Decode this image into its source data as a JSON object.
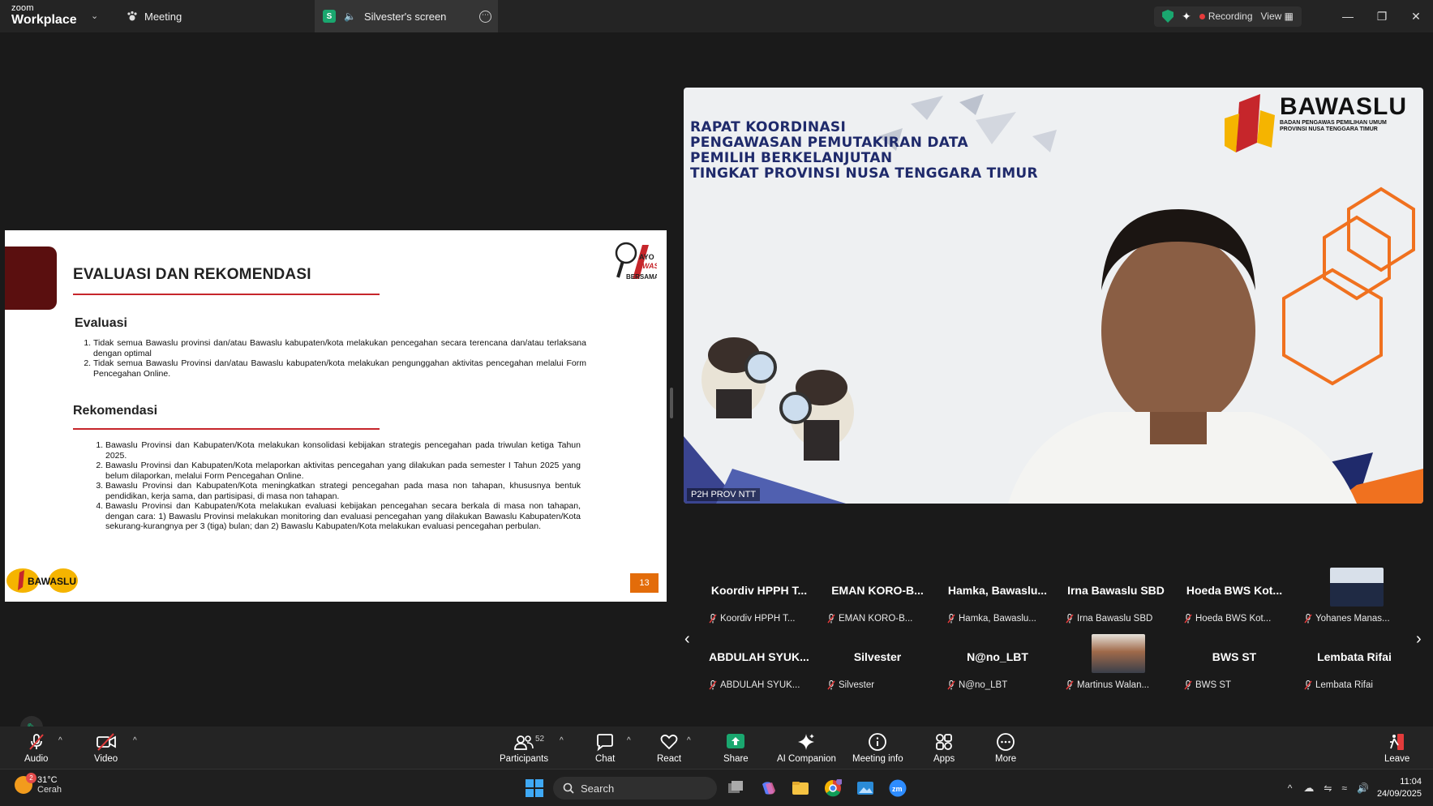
{
  "app": {
    "logo_small": "zoom",
    "logo_big": "Workplace",
    "meeting_tab": "Meeting",
    "screen_tab": "Silvester's screen",
    "screen_tab_badge": "S",
    "status": {
      "recording": "Recording",
      "view": "View"
    }
  },
  "slide": {
    "title": "EVALUASI DAN REKOMENDASI",
    "ayo_logo_text": "AYO AWASI BERSAMA",
    "eval_heading": "Evaluasi",
    "eval_items": [
      "Tidak semua Bawaslu provinsi dan/atau Bawaslu kabupaten/kota melakukan pencegahan secara terencana dan/atau terlaksana dengan optimal",
      "Tidak semua Bawaslu Provinsi dan/atau Bawaslu kabupaten/kota melakukan pengunggahan aktivitas pencegahan melalui Form Pencegahan Online."
    ],
    "rek_heading": "Rekomendasi",
    "rek_items": [
      "Bawaslu Provinsi dan Kabupaten/Kota melakukan konsolidasi kebijakan strategis pencegahan pada triwulan ketiga Tahun 2025.",
      "Bawaslu Provinsi dan Kabupaten/Kota melaporkan aktivitas pencegahan yang dilakukan pada semester I Tahun 2025 yang belum dilaporkan, melalui Form Pencegahan Online.",
      "Bawaslu Provinsi dan Kabupaten/Kota meningkatkan strategi pencegahan pada masa non tahapan, khususnya bentuk pendidikan, kerja sama, dan partisipasi, di masa non tahapan.",
      "Bawaslu Provinsi dan Kabupaten/Kota melakukan evaluasi kebijakan pencegahan secara berkala di masa non tahapan, dengan cara: 1) Bawaslu Provinsi melakukan monitoring dan evaluasi pencegahan yang dilakukan Bawaslu Kabupaten/Kota sekurang-kurangnya per 3 (tiga) bulan; dan 2) Bawaslu Kabupaten/Kota melakukan evaluasi pencegahan perbulan."
    ],
    "footer_logo": "BAWASLU",
    "page_number": "13"
  },
  "video": {
    "banner_lines": [
      "RAPAT KOORDINASI",
      "PENGAWASAN PEMUTAKIRAN DATA",
      "PEMILIH BERKELANJUTAN",
      "TINGKAT PROVINSI NUSA TENGGARA TIMUR"
    ],
    "logo_big": "BAWASLU",
    "logo_small_1": "BADAN PENGAWAS PEMILIHAN UMUM",
    "logo_small_2": "PROVINSI NUSA TENGGARA TIMUR",
    "name": "P2H PROV NTT"
  },
  "participants": [
    {
      "title": "Koordiv HPPH T...",
      "label": "Koordiv HPPH T..."
    },
    {
      "title": "EMAN KORO-B...",
      "label": "EMAN KORO-B..."
    },
    {
      "title": "Hamka,  Bawaslu...",
      "label": "Hamka, Bawaslu..."
    },
    {
      "title": "Irna Bawaslu SBD",
      "label": "Irna Bawaslu SBD"
    },
    {
      "title": "Hoeda BWS Kot...",
      "label": "Hoeda BWS Kot..."
    },
    {
      "title": "",
      "label": "Yohanes Manas..."
    },
    {
      "title": "ABDULAH SYUK...",
      "label": "ABDULAH SYUK..."
    },
    {
      "title": "Silvester",
      "label": "Silvester"
    },
    {
      "title": "N@no_LBT",
      "label": "N@no_LBT"
    },
    {
      "title": "",
      "label": "Martinus Walan..."
    },
    {
      "title": "BWS ST",
      "label": "BWS ST"
    },
    {
      "title": "Lembata Rifai",
      "label": "Lembata Rifai"
    }
  ],
  "toolbar": {
    "audio": "Audio",
    "video": "Video",
    "participants": "Participants",
    "participants_count": "52",
    "chat": "Chat",
    "react": "React",
    "share": "Share",
    "ai_companion": "AI Companion",
    "meeting_info": "Meeting info",
    "apps": "Apps",
    "more": "More",
    "leave": "Leave"
  },
  "taskbar": {
    "weather_badge": "2",
    "temperature": "31°C",
    "condition": "Cerah",
    "search": "Search",
    "time": "11:04",
    "date": "24/09/2025"
  },
  "colors": {
    "accent_green": "#1aa76f",
    "slide_red": "#c6262b",
    "page_orange": "#e36c0a",
    "maroon": "#5a0f0f"
  }
}
